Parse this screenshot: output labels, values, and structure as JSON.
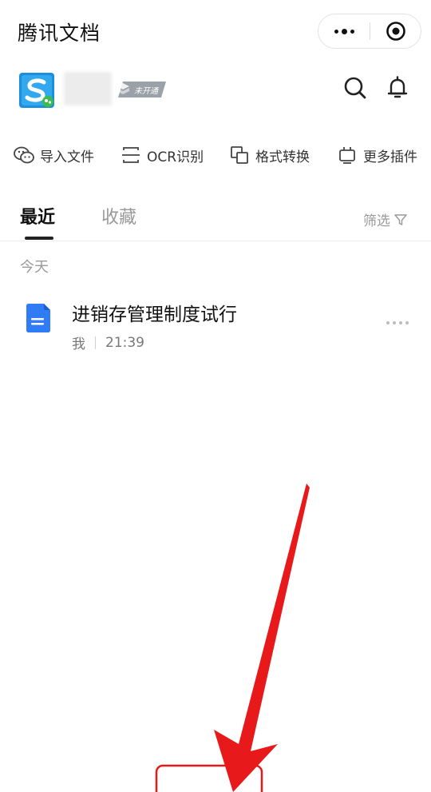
{
  "header": {
    "title": "腾讯文档",
    "capsule_more_icon": "more-dots-icon",
    "capsule_close_icon": "target-icon"
  },
  "profile": {
    "logo_icon": "app-logo",
    "status_badge": "未开通",
    "search_icon": "search-icon",
    "bell_icon": "bell-icon"
  },
  "tools": [
    {
      "label": "导入文件",
      "icon": "wechat-icon"
    },
    {
      "label": "OCR识别",
      "icon": "ocr-icon"
    },
    {
      "label": "格式转换",
      "icon": "convert-icon"
    },
    {
      "label": "更多插件",
      "icon": "plugin-icon"
    }
  ],
  "tabs": [
    {
      "label": "最近",
      "active": true
    },
    {
      "label": "收藏",
      "active": false
    }
  ],
  "filter_label": "筛选",
  "section_label": "今天",
  "documents": [
    {
      "title": "进销存管理制度试行",
      "owner": "我",
      "time": "21:39",
      "icon": "doc-icon"
    }
  ],
  "colors": {
    "accent_blue": "#2f7cf6",
    "annotation_red": "#e8191a"
  }
}
